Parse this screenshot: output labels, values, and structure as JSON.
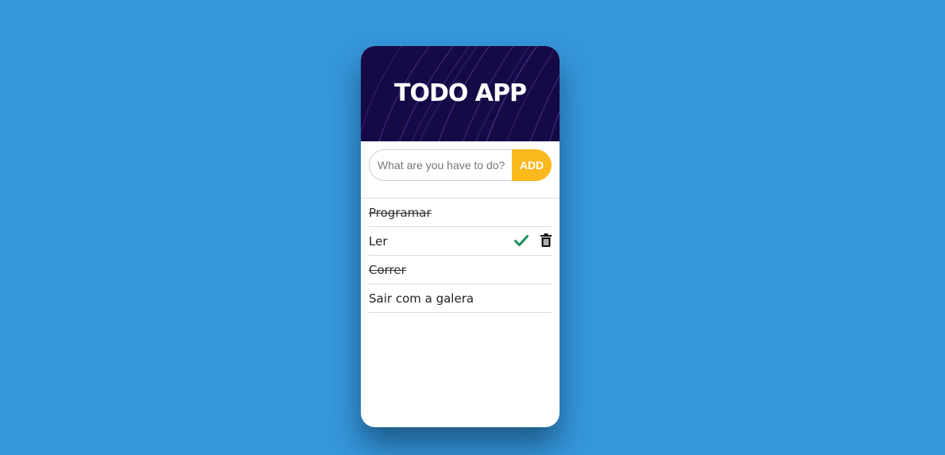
{
  "header": {
    "title": "TODO APP"
  },
  "input": {
    "placeholder": "What are you have to do?",
    "value": ""
  },
  "add_button": {
    "label": "ADD"
  },
  "todos": [
    {
      "text": "Programar",
      "completed": true,
      "actions_visible": false
    },
    {
      "text": "Ler",
      "completed": false,
      "actions_visible": true
    },
    {
      "text": "Correr",
      "completed": true,
      "actions_visible": false
    },
    {
      "text": "Sair com a galera",
      "completed": false,
      "actions_visible": false
    }
  ],
  "icons": {
    "complete": "check-icon",
    "delete": "trash-icon"
  },
  "colors": {
    "background": "#3697db",
    "header": "#150a45",
    "add_button": "#fbb91d",
    "check": "#1a8c5a",
    "trash": "#111111"
  }
}
